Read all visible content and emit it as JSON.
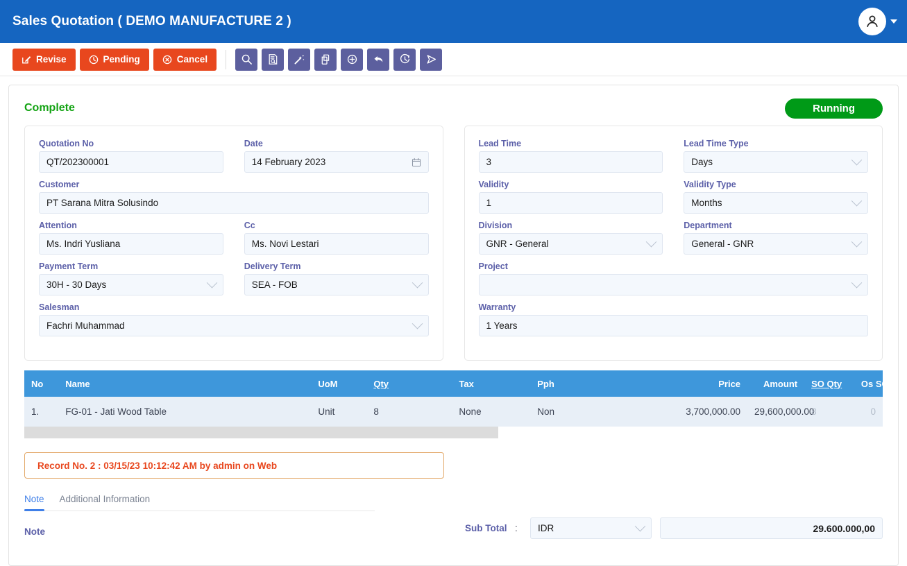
{
  "appbar": {
    "title": "Sales Quotation ( DEMO MANUFACTURE 2 )",
    "avatar_icon": "user-icon",
    "caret_icon": "chevron-down-icon",
    "brand_color": "#1565C0"
  },
  "toolbar": {
    "actions": [
      {
        "label": "Revise",
        "icon": "edit-square-icon",
        "color": "#E8471E"
      },
      {
        "label": "Pending",
        "icon": "clock-icon",
        "color": "#E8471E"
      },
      {
        "label": "Cancel",
        "icon": "circle-x-icon",
        "color": "#E8471E"
      }
    ],
    "icon_buttons": [
      {
        "name": "search-icon",
        "title": "Search"
      },
      {
        "name": "document-search-icon",
        "title": "Find Document"
      },
      {
        "name": "magic-wand-icon",
        "title": "Auto Fill"
      },
      {
        "name": "copy-icon",
        "title": "Copy"
      },
      {
        "name": "plus-circle-icon",
        "title": "Add"
      },
      {
        "name": "undo-arrow-icon",
        "title": "Undo"
      },
      {
        "name": "clock-refresh-icon",
        "title": "History"
      },
      {
        "name": "send-icon",
        "title": "Send"
      }
    ],
    "icon_button_color": "#5C5F9E"
  },
  "status": {
    "complete_label": "Complete",
    "complete_color": "#13A313",
    "badge_label": "Running",
    "badge_color": "#009A17"
  },
  "left_panel": {
    "quotation_no": {
      "label": "Quotation No",
      "value": "QT/202300001"
    },
    "date": {
      "label": "Date",
      "value": "14 February 2023",
      "icon": "calendar-icon"
    },
    "customer": {
      "label": "Customer",
      "value": "PT Sarana Mitra Solusindo"
    },
    "attention": {
      "label": "Attention",
      "value": "Ms. Indri Yusliana"
    },
    "cc": {
      "label": "Cc",
      "value": "Ms. Novi Lestari"
    },
    "payment_term": {
      "label": "Payment Term",
      "value": "30H - 30 Days"
    },
    "delivery_term": {
      "label": "Delivery Term",
      "value": "SEA - FOB"
    },
    "salesman": {
      "label": "Salesman",
      "value": "Fachri Muhammad"
    }
  },
  "right_panel": {
    "lead_time": {
      "label": "Lead Time",
      "value": "3"
    },
    "lead_time_type": {
      "label": "Lead Time Type",
      "value": "Days"
    },
    "validity": {
      "label": "Validity",
      "value": "1"
    },
    "validity_type": {
      "label": "Validity Type",
      "value": "Months"
    },
    "division": {
      "label": "Division",
      "value": "GNR - General"
    },
    "department": {
      "label": "Department",
      "value": "General - GNR"
    },
    "project": {
      "label": "Project",
      "value": "",
      "placeholder": ""
    },
    "warranty": {
      "label": "Warranty",
      "value": "1 Years"
    }
  },
  "items_table": {
    "columns": [
      {
        "label": "No",
        "align": "left",
        "underline": false
      },
      {
        "label": "Name",
        "align": "left",
        "underline": false
      },
      {
        "label": "UoM",
        "align": "left",
        "underline": false
      },
      {
        "label": "Qty",
        "align": "left",
        "underline": true
      },
      {
        "label": "Tax",
        "align": "left",
        "underline": false
      },
      {
        "label": "Pph",
        "align": "left",
        "underline": false
      },
      {
        "label": "Price",
        "align": "right",
        "underline": false
      },
      {
        "label": "Amount",
        "align": "right",
        "underline": false
      },
      {
        "label": "SO Qty",
        "align": "left",
        "underline": true
      },
      {
        "label": "Os SO",
        "align": "right",
        "underline": false
      }
    ],
    "header_color": "#3E97DB",
    "rows": [
      {
        "no": "1.",
        "name": "FG-01 - Jati Wood Table",
        "uom": "Unit",
        "qty": "8",
        "tax": "None",
        "pph": "Non",
        "price": "3,700,000.00",
        "amount": "29,600,000.00",
        "so_qty": "8",
        "os_so": "0"
      }
    ]
  },
  "record_note": {
    "text": "Record No. 2 : 03/15/23 10:12:42 AM by admin on Web",
    "color": "#E8471E"
  },
  "tabs": [
    {
      "label": "Note",
      "active": true
    },
    {
      "label": "Additional Information",
      "active": false
    }
  ],
  "note_section": {
    "heading": "Note"
  },
  "totals": {
    "sub_total_label": "Sub Total",
    "separator": ":",
    "currency": "IDR",
    "amount": "29.600.000,00"
  }
}
